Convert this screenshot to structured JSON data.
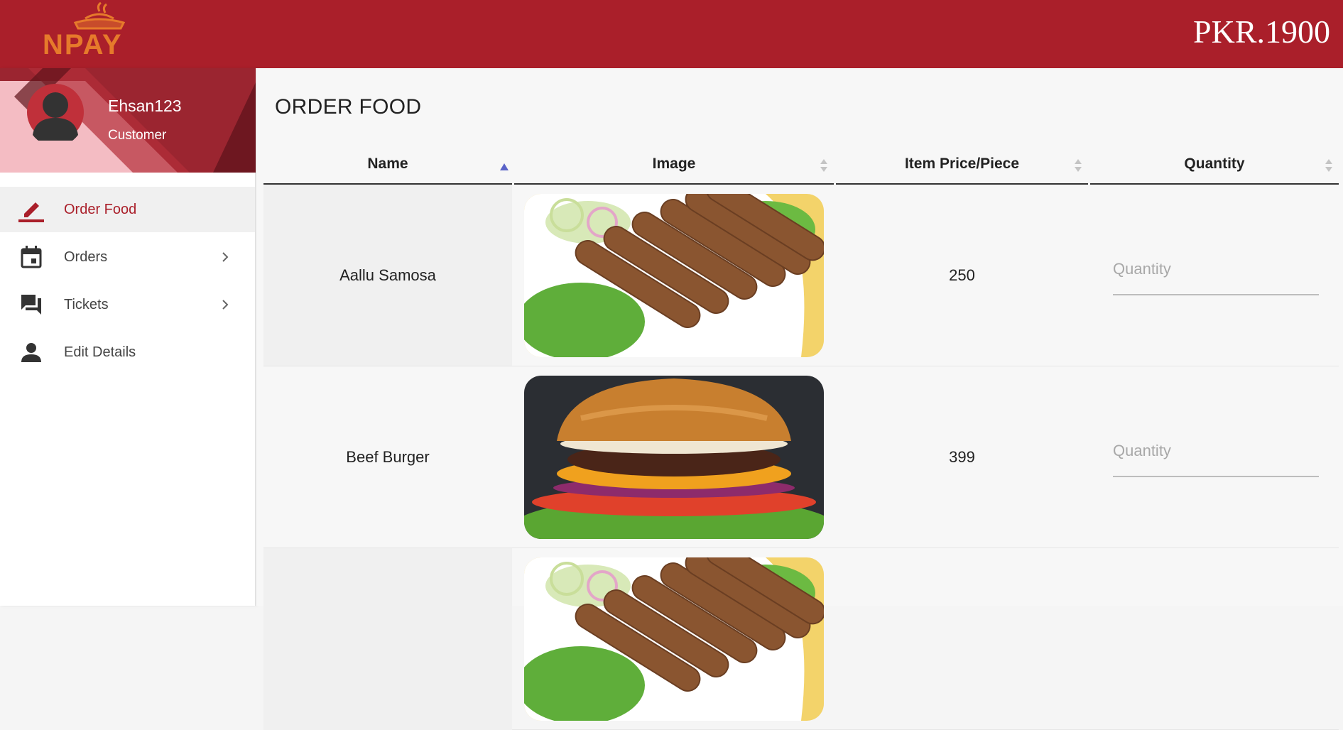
{
  "header": {
    "logo_text": "NPAY",
    "balance": "PKR.1900",
    "colors": {
      "brand": "#aa1f2a",
      "logo": "#e67a2b"
    }
  },
  "profile": {
    "username": "Ehsan123",
    "role": "Customer"
  },
  "nav": [
    {
      "label": "Order Food",
      "icon": "pencil-icon",
      "active": true,
      "has_chevron": false
    },
    {
      "label": "Orders",
      "icon": "calendar-icon",
      "active": false,
      "has_chevron": true
    },
    {
      "label": "Tickets",
      "icon": "forum-icon",
      "active": false,
      "has_chevron": true
    },
    {
      "label": "Edit Details",
      "icon": "person-icon",
      "active": false,
      "has_chevron": false
    }
  ],
  "page": {
    "title": "ORDER FOOD"
  },
  "table": {
    "columns": [
      "Name",
      "Image",
      "Item Price/Piece",
      "Quantity"
    ],
    "sorted_column": "Name",
    "sort_direction": "ascending",
    "rows": [
      {
        "name": "Aallu Samosa",
        "image": "seekh-kebab-image",
        "price": "250",
        "quantity_placeholder": "Quantity"
      },
      {
        "name": "Beef Burger",
        "image": "burger-image",
        "price": "399",
        "quantity_placeholder": "Quantity"
      },
      {
        "name": "",
        "image": "seekh-kebab-image",
        "price": "",
        "quantity_placeholder": ""
      }
    ]
  }
}
